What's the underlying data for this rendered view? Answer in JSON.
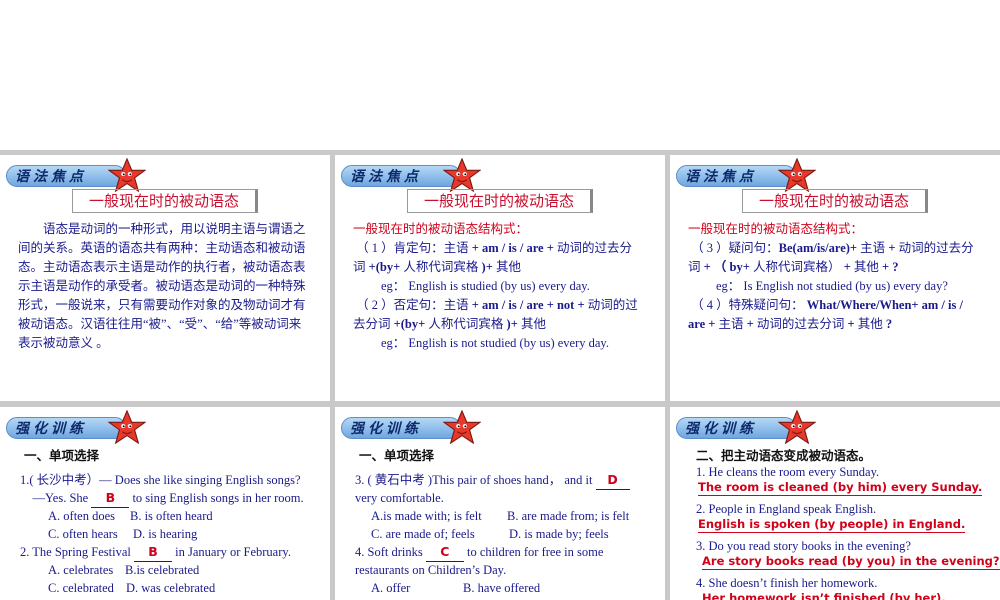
{
  "badges": {
    "grammar": "语法焦点",
    "practice": "强化训练"
  },
  "panel1": {
    "title": "一般现在时的被动语态",
    "paragraph": [
      "　　语态是动词的一种形式，用以说明主语与谓语之",
      "间的关系。英语的语态共有两种：主动语态和被动语",
      "态。主动语态表示主语是动作的执行者，被动语态表",
      "示主语是动作的承受者。被动语态是动词的一种特殊",
      "形式，一般说来，只有需要动作对象的及物动词才有",
      "被动语态。汉语往往用“被”、“受”、“给”等被动词来",
      "表示被动意义 。"
    ]
  },
  "panel2": {
    "title": "一般现在时的被动语态",
    "structure_label": "一般现在时的被动语态结构式：",
    "aff_prefix": "（ 1 ）肯定句：主语 ",
    "aff_formula": "+ am / is / are +",
    "aff_mid": " 动词的过去分",
    "aff_line2a": "词 ",
    "aff_formula2": "+(by+",
    "aff_line2b": " 人称代词宾格 ",
    "aff_formula3": ")+",
    "aff_line2c": " 其他",
    "aff_example": "eg： English is studied (by us) every day.",
    "neg_prefix": "（ 2 ）否定句：主语 ",
    "neg_formula": "+ am / is / are + not +",
    "neg_mid": " 动词的过",
    "neg_line2a": "去分词 ",
    "neg_formula2": "+(by+",
    "neg_line2b": " 人称代词宾格 ",
    "neg_formula3": ")+",
    "neg_line2c": " 其他",
    "neg_example": "eg： English is not studied (by us) every day."
  },
  "panel3": {
    "title": "一般现在时的被动语态",
    "structure_label": "一般现在时的被动语态结构式：",
    "q_prefix": "（ 3 ）疑问句：",
    "q_formula": "Be(am/is/are)+",
    "q_mid": " 主语 ",
    "q_formula_b": "+",
    "q_tail": " 动词的过去分",
    "q_line2a": "词 ",
    "q_line2b": "+ （ ",
    "q_line2c": "by+",
    "q_line2d": " 人称代词宾格） ",
    "q_line2e": "+",
    "q_line2f": " 其他 ",
    "q_line2g": "+ ?",
    "q_example": "eg： Is English not studied (by us) every day?",
    "wh_prefix": "（ 4 ）特殊疑问句： ",
    "wh_formula": "What/Where/When+ am / is /",
    "wh_line2a": "are +",
    "wh_line2b": " 主语 ",
    "wh_line2c": "+",
    "wh_line2d": " 动词的过去分词 ",
    "wh_line2e": "+",
    "wh_line2f": " 其他 ",
    "wh_line2g": "?"
  },
  "panel4": {
    "heading": "一、单项选择",
    "q1a": "1.( 长沙中考）— Does she like singing English songs?",
    "q1b_pre": "　—Yes. She ",
    "q1b_ans": "B",
    "q1b_post": " to sing English songs in her room.",
    "q1_optA": "A. often does",
    "q1_optB": "B. is often heard",
    "q1_optC": "C. often hears",
    "q1_optD": "D. is hearing",
    "q2_pre": "2. The Spring Festival ",
    "q2_ans": "B",
    "q2_post": " in January or February.",
    "q2_optA": "A. celebrates",
    "q2_optB": "B.is celebrated",
    "q2_optC": "C. celebrated",
    "q2_optD": "D. was celebrated"
  },
  "panel5": {
    "heading": "一、单项选择",
    "q3_pre": "3. ( 黄石中考 )This pair of shoes hand，  and it ",
    "q3_ans": "D",
    "q3_line2": "very comfortable.",
    "q3_optA": "A.is made with; is felt",
    "q3_optB": "B. are made from; is felt",
    "q3_optC": "C. are made of; feels",
    "q3_optD": "D. is made by; feels",
    "q4_pre": "4. Soft drinks ",
    "q4_ans": "C",
    "q4_post": " to children for free in some",
    "q4_line2": "restaurants on Children’s Day.",
    "q4_optA": "A. offer",
    "q4_optB": "B. have offered"
  },
  "panel6": {
    "heading": "二、把主动语态变成被动语态。",
    "items": [
      {
        "q": "1. He cleans the room every Sunday.",
        "a": "The room is cleaned (by him) every Sunday."
      },
      {
        "q": "2. People in England speak English.",
        "a": "English is spoken (by people) in England."
      },
      {
        "q": "3. Do you read story books in the evening?",
        "a": "Are story books read (by you) in the evening?"
      },
      {
        "q": "4. She doesn’t finish her homework.",
        "a": "Her homework isn’t finished (by her)."
      }
    ]
  }
}
